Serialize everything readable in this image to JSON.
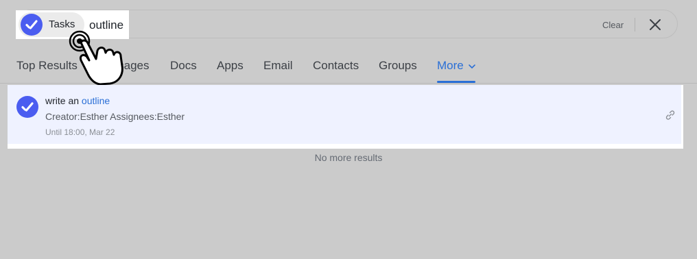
{
  "search": {
    "filter_chip": {
      "label": "Tasks",
      "icon": "tasks-check-icon"
    },
    "query": "outline",
    "clear_label": "Clear",
    "close_icon": "close-icon"
  },
  "tabs": [
    {
      "label": "Top Results",
      "active": false
    },
    {
      "label": "Messages",
      "active": false
    },
    {
      "label": "Docs",
      "active": false
    },
    {
      "label": "Apps",
      "active": false
    },
    {
      "label": "Email",
      "active": false
    },
    {
      "label": "Contacts",
      "active": false
    },
    {
      "label": "Groups",
      "active": false
    },
    {
      "label": "More",
      "active": true,
      "icon": "chevron-down-icon"
    }
  ],
  "results": [
    {
      "icon": "tasks-check-icon",
      "title_prefix": "write an ",
      "title_highlight": "outline",
      "meta": "Creator:Esther Assignees:Esther",
      "due": "Until 18:00, Mar 22",
      "action_icon": "link-icon"
    }
  ],
  "footer": {
    "no_more": "No more results"
  },
  "colors": {
    "accent": "#2a6fd6",
    "task_icon": "#4b5df0",
    "result_bg": "#eff2ff"
  }
}
